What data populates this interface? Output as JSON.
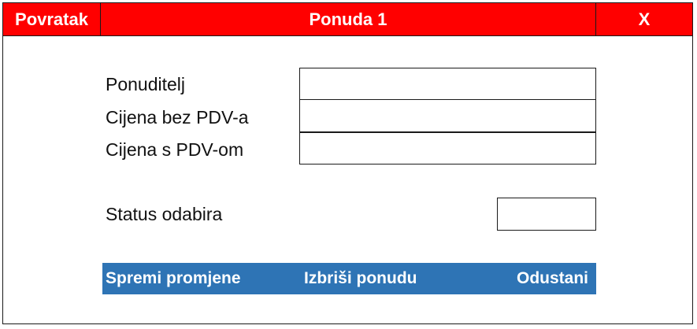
{
  "titlebar": {
    "back_label": "Povratak",
    "title": "Ponuda 1",
    "close_label": "X"
  },
  "form": {
    "fields": [
      {
        "label": "Ponuditelj",
        "value": ""
      },
      {
        "label": "Cijena bez PDV-a",
        "value": ""
      },
      {
        "label": "Cijena s PDV-om",
        "value": ""
      }
    ],
    "status_label": "Status odabira",
    "status_value": ""
  },
  "actions": {
    "save_label": "Spremi promjene",
    "delete_label": "Izbriši ponudu",
    "cancel_label": "Odustani"
  },
  "colors": {
    "titlebar": "#ff0000",
    "actionbar": "#2e74b5"
  }
}
